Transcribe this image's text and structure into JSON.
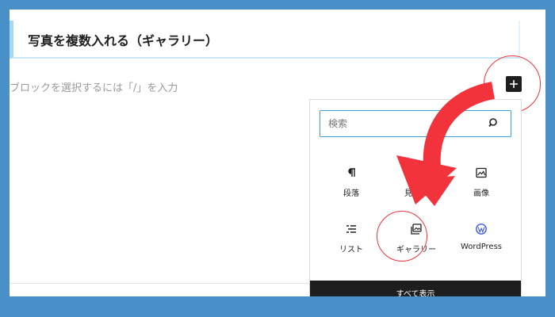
{
  "editor": {
    "heading": "写真を複数入れる（ギャラリー）",
    "placeholder": "ブロックを選択するには「/」を入力"
  },
  "inserter": {
    "search": {
      "placeholder": "検索",
      "value": ""
    },
    "blocks": [
      {
        "label": "段落",
        "icon": "paragraph-icon"
      },
      {
        "label": "見出し",
        "icon": "heading-icon"
      },
      {
        "label": "画像",
        "icon": "image-icon"
      },
      {
        "label": "リスト",
        "icon": "list-icon"
      },
      {
        "label": "ギャラリー",
        "icon": "gallery-icon"
      },
      {
        "label": "WordPress",
        "icon": "wordpress-icon"
      }
    ],
    "show_all": "すべて表示"
  },
  "annotations": {
    "color": "#f2333b"
  }
}
